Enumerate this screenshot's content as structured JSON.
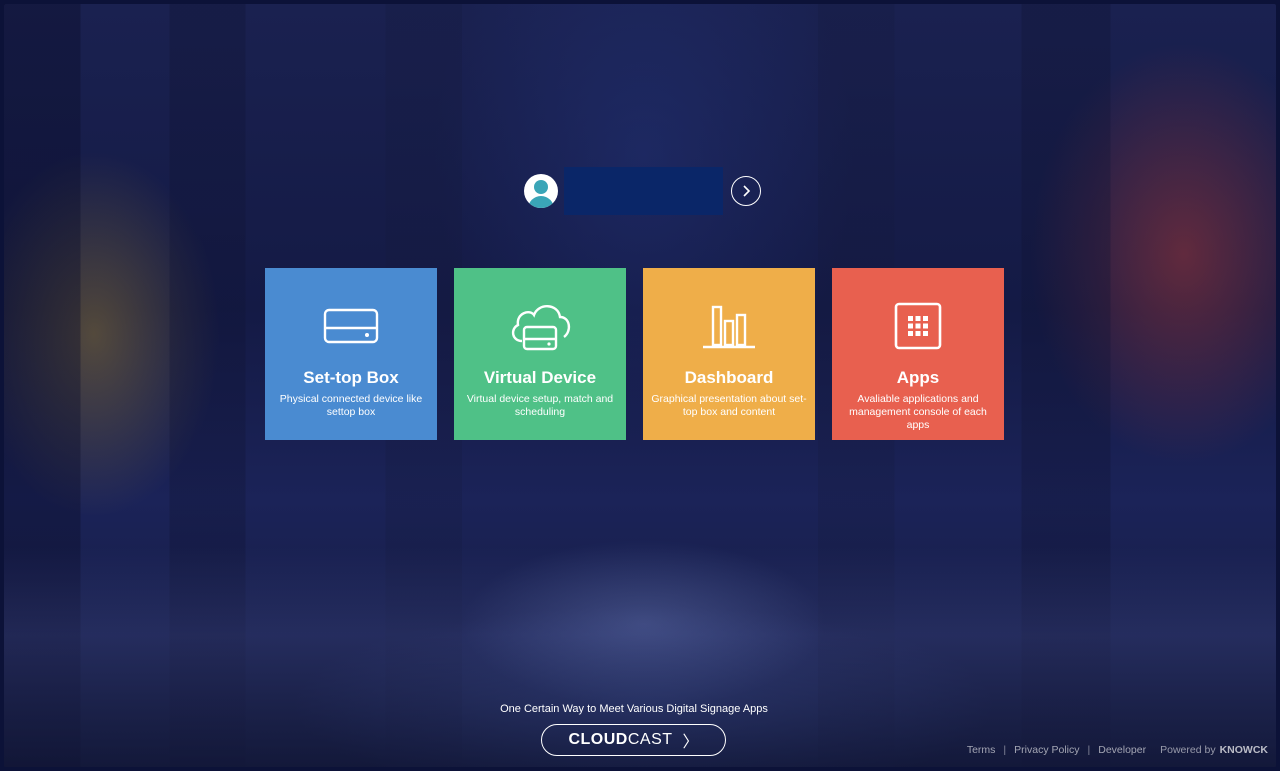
{
  "login": {
    "username_value": "",
    "go_icon": "chevron-right-circle-icon",
    "avatar_icon": "user-avatar-icon"
  },
  "tiles": [
    {
      "title": "Set-top Box",
      "desc": "Physical connected device like settop box",
      "color": "#4a8bd1",
      "icon": "hard-drive-icon"
    },
    {
      "title": "Virtual Device",
      "desc": "Virtual device setup, match and scheduling",
      "color": "#4fc187",
      "icon": "cloud-drive-icon"
    },
    {
      "title": "Dashboard",
      "desc": "Graphical presentation about set-top box and content",
      "color": "#efae49",
      "icon": "bar-chart-icon"
    },
    {
      "title": "Apps",
      "desc": "Avaliable applications and management console of each apps",
      "color": "#e8604f",
      "icon": "grid-apps-icon"
    }
  ],
  "footer": {
    "tagline": "One Certain Way to Meet Various Digital Signage Apps",
    "brand_strong": "CLOUD",
    "brand_light": "CAST",
    "brand_chevron": "〉",
    "links": {
      "terms": "Terms",
      "privacy": "Privacy Policy",
      "developer": "Developer"
    },
    "powered_prefix": "Powered by",
    "powered_brand": "KNOWCK"
  }
}
